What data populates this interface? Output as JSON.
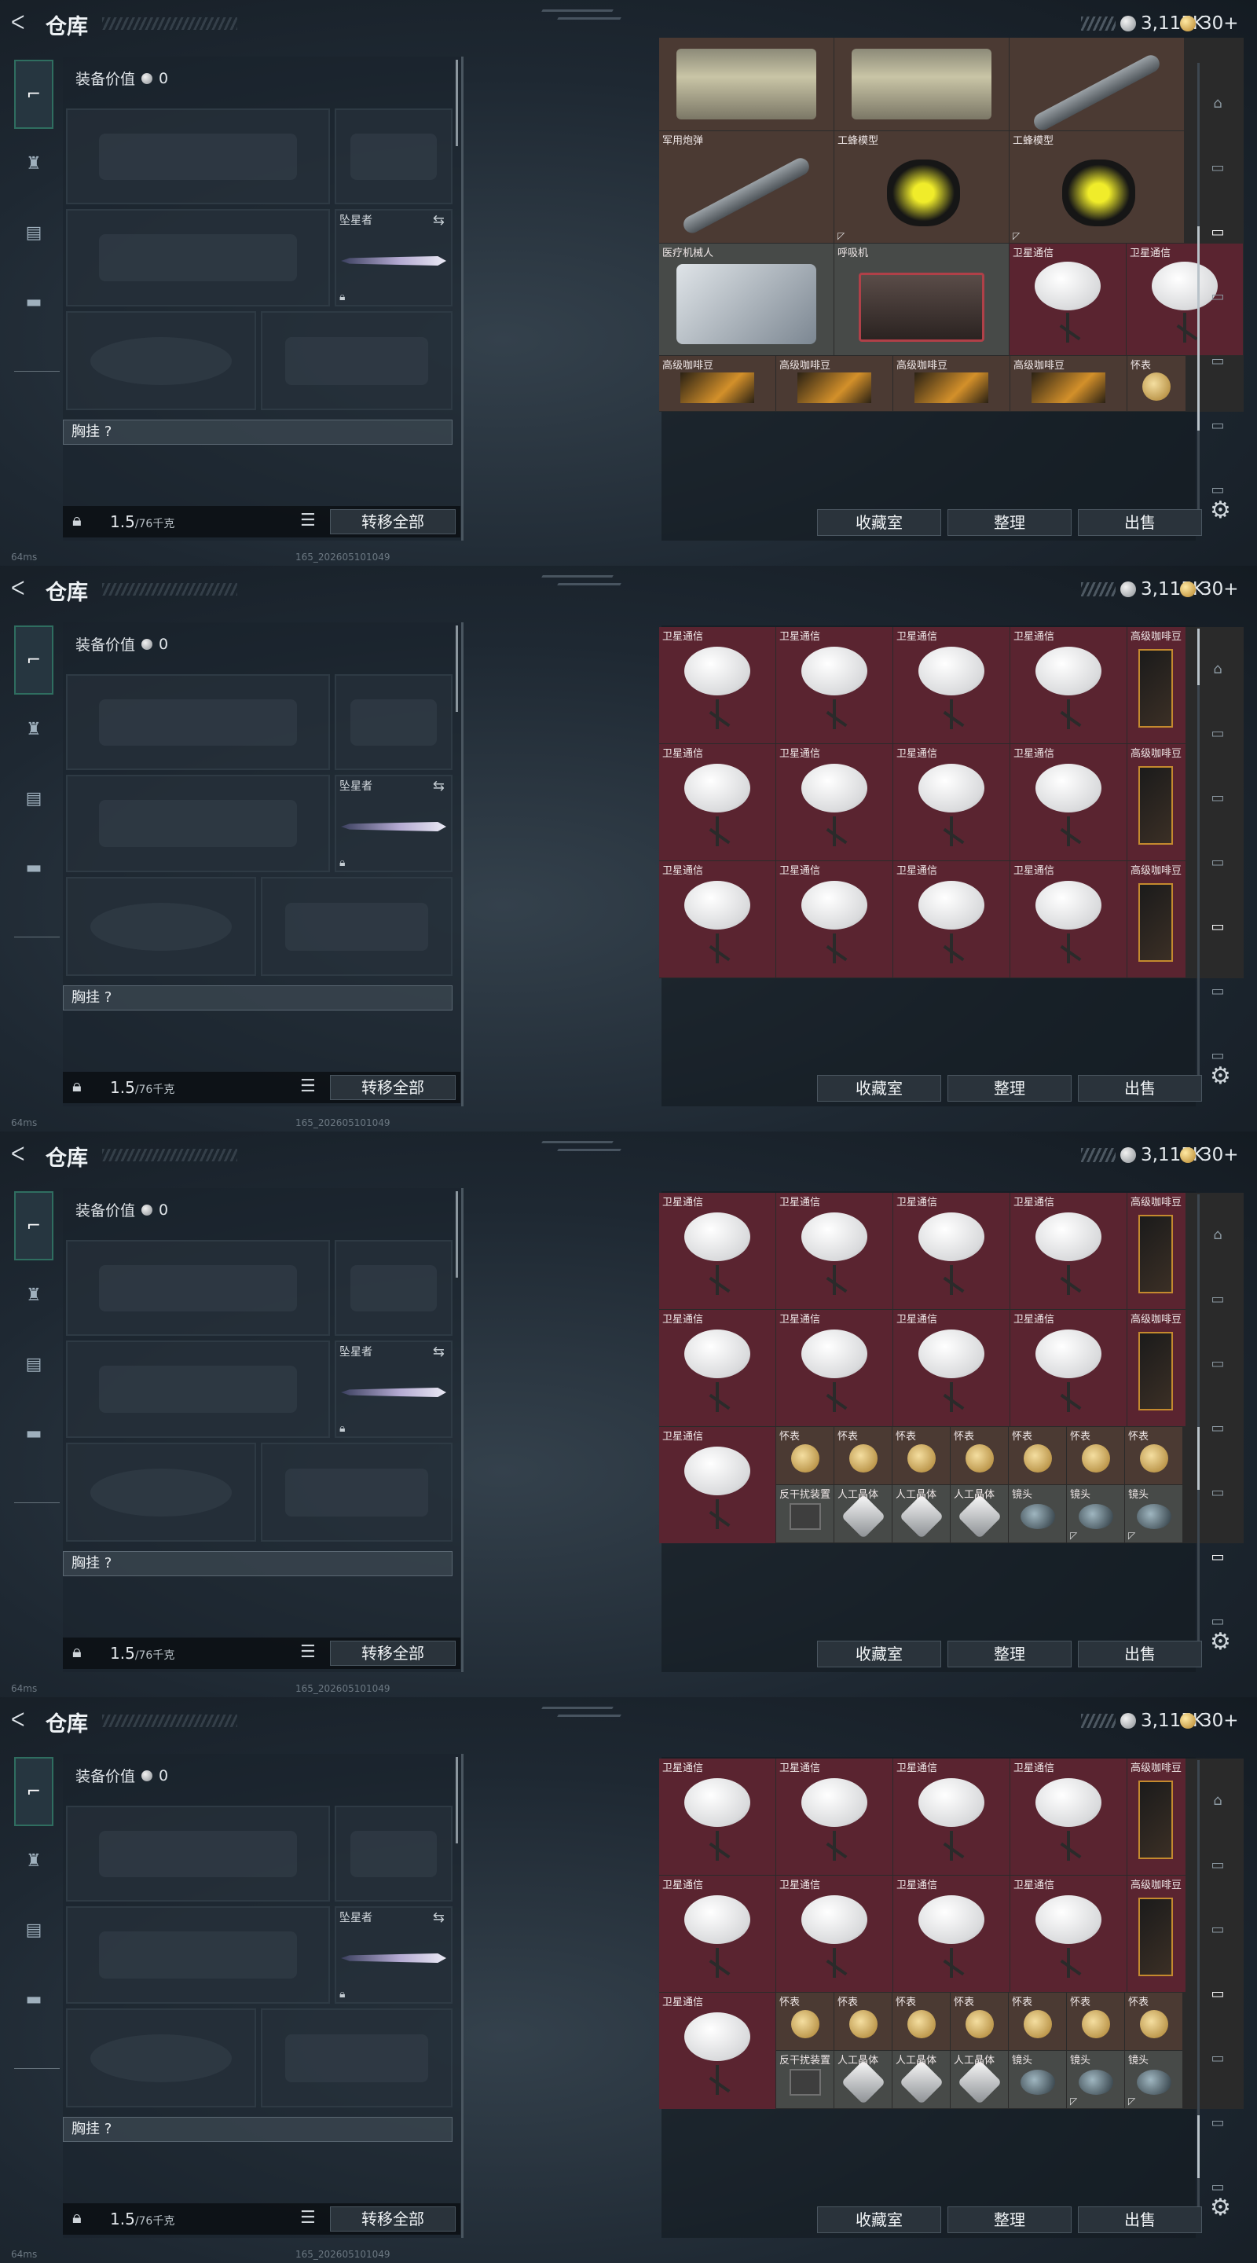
{
  "app": {
    "title": "仓库",
    "currency_1": "3,115K",
    "currency_2": "30+",
    "equip_value_label": "装备价值",
    "equip_value": "0",
    "secondary_slot_name": "坠星者",
    "chest_label": "胸挂 ?",
    "weight": "1.5",
    "weight_capacity": "/76千克",
    "transfer_all": "转移全部",
    "btn_collection": "收藏室",
    "btn_sort": "整理",
    "btn_sell": "出售",
    "ping": "64ms",
    "build": "165_20260510104​9",
    "left_nav": [
      "gun-icon",
      "helmet-icon",
      "vest-icon",
      "briefcase-icon"
    ]
  },
  "colors": {
    "cell": "#5a2430",
    "accent": "#2f6e60"
  },
  "panels": [
    {
      "rows": [
        [
          {
            "n": "",
            "t": "case",
            "c": "brown"
          },
          {
            "n": "",
            "t": "case",
            "c": "brown"
          },
          {
            "n": "",
            "t": "missile",
            "c": "brown"
          }
        ],
        [
          {
            "n": "军用炮弹",
            "t": "missile",
            "c": "brown"
          },
          {
            "n": "工蜂模型",
            "t": "wasp",
            "c": "brown",
            "b": "◸"
          },
          {
            "n": "工蜂模型",
            "t": "wasp",
            "c": "brown",
            "b": "◸"
          }
        ],
        [
          {
            "n": "医疗机械人",
            "t": "robot",
            "c": "grey"
          },
          {
            "n": "呼吸机",
            "t": "breath",
            "c": "grey"
          },
          {
            "n": "卫星通信",
            "t": "dish"
          },
          {
            "n": "卫星通信",
            "t": "dish"
          }
        ],
        [
          {
            "n": "高级咖啡豆",
            "t": "coffeeopen",
            "c": "brown"
          },
          {
            "n": "高级咖啡豆",
            "t": "coffeeopen",
            "c": "brown"
          },
          {
            "n": "高级咖啡豆",
            "t": "coffeeopen",
            "c": "brown"
          },
          {
            "n": "高级咖啡豆",
            "t": "coffeeopen",
            "c": "brown"
          },
          {
            "n": "怀表",
            "t": "watch",
            "c": "brown"
          }
        ]
      ]
    },
    {
      "rows": [
        [
          {
            "n": "卫星通信",
            "t": "dish"
          },
          {
            "n": "卫星通信",
            "t": "dish"
          },
          {
            "n": "卫星通信",
            "t": "dish"
          },
          {
            "n": "卫星通信",
            "t": "dish"
          },
          {
            "n": "高级咖啡豆",
            "t": "coffee"
          }
        ],
        [
          {
            "n": "卫星通信",
            "t": "dish"
          },
          {
            "n": "卫星通信",
            "t": "dish"
          },
          {
            "n": "卫星通信",
            "t": "dish"
          },
          {
            "n": "卫星通信",
            "t": "dish"
          },
          {
            "n": "高级咖啡豆",
            "t": "coffee"
          }
        ],
        [
          {
            "n": "卫星通信",
            "t": "dish"
          },
          {
            "n": "卫星通信",
            "t": "dish"
          },
          {
            "n": "卫星通信",
            "t": "dish"
          },
          {
            "n": "卫星通信",
            "t": "dish"
          },
          {
            "n": "高级咖啡豆",
            "t": "coffee"
          }
        ]
      ]
    },
    {
      "rows": [
        [
          {
            "n": "卫星通信",
            "t": "dish"
          },
          {
            "n": "卫星通信",
            "t": "dish"
          },
          {
            "n": "卫星通信",
            "t": "dish"
          },
          {
            "n": "卫星通信",
            "t": "dish"
          },
          {
            "n": "高级咖啡豆",
            "t": "coffee"
          }
        ],
        [
          {
            "n": "卫星通信",
            "t": "dish"
          },
          {
            "n": "卫星通信",
            "t": "dish"
          },
          {
            "n": "卫星通信",
            "t": "dish"
          },
          {
            "n": "卫星通信",
            "t": "dish"
          },
          {
            "n": "高级咖啡豆",
            "t": "coffee"
          }
        ]
      ],
      "mixed": {
        "dish": {
          "n": "卫星通信",
          "t": "dish"
        },
        "watches": [
          "怀表",
          "怀表",
          "怀表",
          "怀表",
          "怀表",
          "怀表",
          "怀表"
        ],
        "bottom": [
          {
            "n": "反干扰装置",
            "t": "jammer"
          },
          {
            "n": "人工晶体",
            "t": "diamond"
          },
          {
            "n": "人工晶体",
            "t": "diamond"
          },
          {
            "n": "人工晶体",
            "t": "diamond"
          },
          {
            "n": "镜头",
            "t": "scope"
          },
          {
            "n": "镜头",
            "t": "scope",
            "b": "◸"
          },
          {
            "n": "镜头",
            "t": "scope",
            "b": "◸"
          }
        ]
      }
    },
    {
      "rows": [
        [
          {
            "n": "卫星通信",
            "t": "dish"
          },
          {
            "n": "卫星通信",
            "t": "dish"
          },
          {
            "n": "卫星通信",
            "t": "dish"
          },
          {
            "n": "卫星通信",
            "t": "dish"
          },
          {
            "n": "高级咖啡豆",
            "t": "coffee"
          }
        ],
        [
          {
            "n": "卫星通信",
            "t": "dish"
          },
          {
            "n": "卫星通信",
            "t": "dish"
          },
          {
            "n": "卫星通信",
            "t": "dish"
          },
          {
            "n": "卫星通信",
            "t": "dish"
          },
          {
            "n": "高级咖啡豆",
            "t": "coffee"
          }
        ]
      ],
      "mixed": {
        "dish": {
          "n": "卫星通信",
          "t": "dish"
        },
        "watches": [
          "怀表",
          "怀表",
          "怀表",
          "怀表",
          "怀表",
          "怀表",
          "怀表"
        ],
        "bottom": [
          {
            "n": "反干扰装置",
            "t": "jammer"
          },
          {
            "n": "人工晶体",
            "t": "diamond"
          },
          {
            "n": "人工晶体",
            "t": "diamond"
          },
          {
            "n": "人工晶体",
            "t": "diamond"
          },
          {
            "n": "镜头",
            "t": "scope"
          },
          {
            "n": "镜头",
            "t": "scope",
            "b": "◸"
          },
          {
            "n": "镜头",
            "t": "scope",
            "b": "◸"
          }
        ]
      }
    }
  ]
}
